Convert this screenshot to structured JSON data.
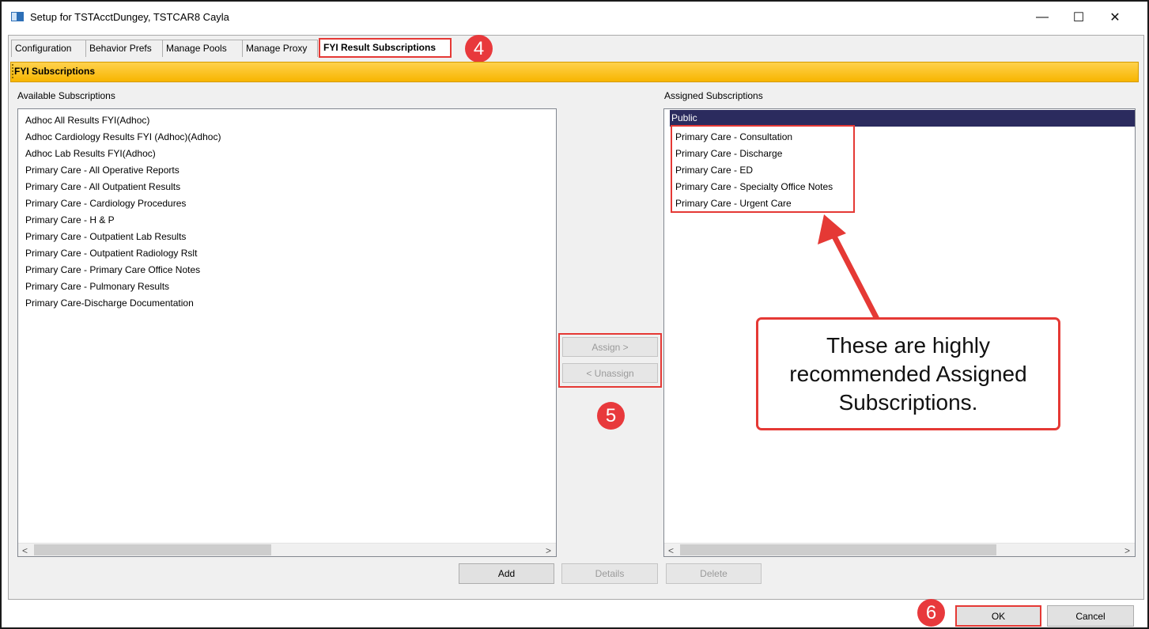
{
  "window": {
    "title": "Setup for TSTAcctDungey, TSTCAR8 Cayla",
    "controls": {
      "minimize": "—",
      "maximize": "☐",
      "close": "✕"
    }
  },
  "tabs": [
    {
      "label": "Configuration",
      "active": false
    },
    {
      "label": "Behavior Prefs",
      "active": false
    },
    {
      "label": "Manage Pools",
      "active": false
    },
    {
      "label": "Manage Proxy",
      "active": false
    },
    {
      "label": "FYI Result Subscriptions",
      "active": true
    }
  ],
  "section": {
    "title": "FYI Subscriptions"
  },
  "available": {
    "label": "Available Subscriptions",
    "items": [
      "Adhoc All Results FYI(Adhoc)",
      "Adhoc Cardiology Results FYI (Adhoc)(Adhoc)",
      "Adhoc Lab Results FYI(Adhoc)",
      "Primary Care - All Operative Reports",
      "Primary Care - All Outpatient Results",
      "Primary Care - Cardiology Procedures",
      "Primary Care - H & P",
      "Primary Care - Outpatient Lab Results",
      "Primary Care - Outpatient Radiology Rslt",
      "Primary Care - Primary Care Office Notes",
      "Primary Care - Pulmonary Results",
      "Primary Care-Discharge Documentation"
    ]
  },
  "assigned": {
    "label": "Assigned Subscriptions",
    "selected": "Public",
    "items": [
      "Primary Care - Consultation",
      "Primary Care - Discharge",
      "Primary Care - ED",
      "Primary Care - Specialty Office Notes",
      "Primary Care - Urgent Care"
    ]
  },
  "buttons": {
    "assign": "Assign >",
    "unassign": "< Unassign",
    "add": "Add",
    "details": "Details",
    "delete": "Delete",
    "ok": "OK",
    "cancel": "Cancel"
  },
  "scroll": {
    "left": "<",
    "right": ">"
  },
  "annotations": {
    "step4": "4",
    "step5": "5",
    "step6": "6",
    "note": "These are highly recommended Assigned Subscriptions.",
    "color": "#e53935"
  }
}
